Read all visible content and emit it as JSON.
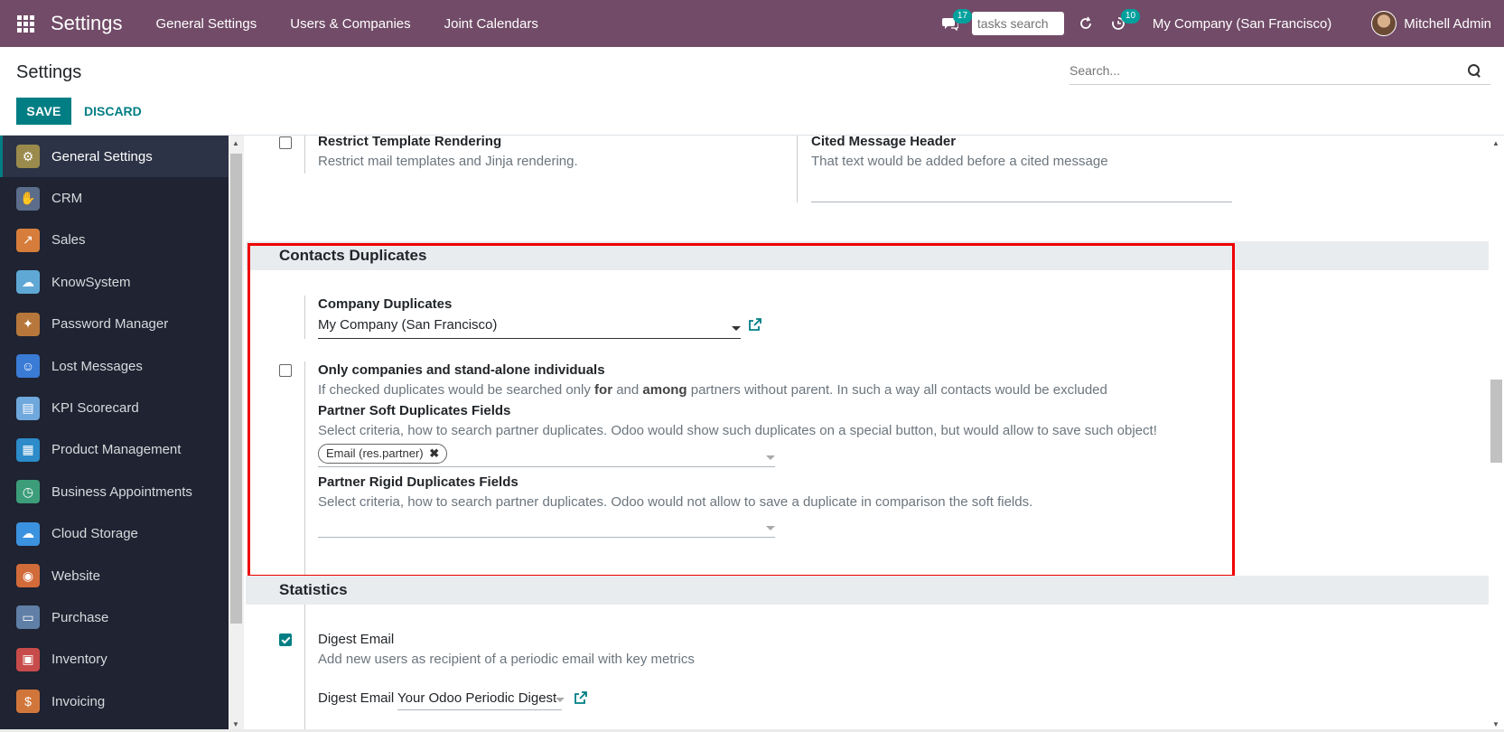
{
  "navbar": {
    "brand": "Settings",
    "menus": [
      "General Settings",
      "Users & Companies",
      "Joint Calendars"
    ],
    "messages_badge": "17",
    "task_search_placeholder": "tasks search",
    "activity_badge": "10",
    "company": "My Company (San Francisco)",
    "user": "Mitchell Admin"
  },
  "control_panel": {
    "title": "Settings",
    "save_label": "SAVE",
    "discard_label": "DISCARD",
    "search_placeholder": "Search..."
  },
  "sidebar": {
    "items": [
      {
        "label": "General Settings",
        "icon": "gear-icon",
        "color": "#9a8b4d",
        "active": true
      },
      {
        "label": "CRM",
        "icon": "handshake-icon",
        "color": "#5b6d8a"
      },
      {
        "label": "Sales",
        "icon": "chart-icon",
        "color": "#d67d3c"
      },
      {
        "label": "KnowSystem",
        "icon": "brain-icon",
        "color": "#5fa8d6"
      },
      {
        "label": "Password Manager",
        "icon": "puzzle-icon",
        "color": "#b7773b"
      },
      {
        "label": "Lost Messages",
        "icon": "user-icon",
        "color": "#3a7bd5"
      },
      {
        "label": "KPI Scorecard",
        "icon": "scorecard-icon",
        "color": "#6fa8dc"
      },
      {
        "label": "Product Management",
        "icon": "product-grid-icon",
        "color": "#2c8bc8"
      },
      {
        "label": "Business Appointments",
        "icon": "clock-icon",
        "color": "#3c9d7a"
      },
      {
        "label": "Cloud Storage",
        "icon": "cloud-icon",
        "color": "#3b93e0"
      },
      {
        "label": "Website",
        "icon": "globe-icon",
        "color": "#d16b3a"
      },
      {
        "label": "Purchase",
        "icon": "card-icon",
        "color": "#5f7fa6"
      },
      {
        "label": "Inventory",
        "icon": "box-icon",
        "color": "#c84b4b"
      },
      {
        "label": "Invoicing",
        "icon": "invoice-icon",
        "color": "#d1763b"
      }
    ]
  },
  "top_settings": {
    "restrict_title": "Restrict Template Rendering",
    "restrict_desc": "Restrict mail templates and Jinja rendering.",
    "cited_title": "Cited Message Header",
    "cited_desc": "That text would be added before a cited message"
  },
  "contacts_duplicates": {
    "heading": "Contacts Duplicates",
    "company_dup_label": "Company Duplicates",
    "company_dup_value": "My Company (San Francisco)",
    "only_companies_title": "Only companies and stand-alone individuals",
    "only_companies_desc_1": "If checked duplicates would be searched only ",
    "only_companies_desc_for": "for",
    "only_companies_desc_2": " and ",
    "only_companies_desc_among": "among",
    "only_companies_desc_3": " partners without parent. In such a way all contacts would be excluded",
    "soft_title": "Partner Soft Duplicates Fields",
    "soft_desc": "Select criteria, how to search partner duplicates. Odoo would show such duplicates on a special button, but would allow to save such object!",
    "soft_tag": "Email (res.partner)",
    "rigid_title": "Partner Rigid Duplicates Fields",
    "rigid_desc": "Select criteria, how to search partner duplicates. Odoo would not allow to save a duplicate in comparison the soft fields."
  },
  "statistics": {
    "heading": "Statistics",
    "digest_title": "Digest Email",
    "digest_desc": "Add new users as recipient of a periodic email with key metrics",
    "digest_field_label": "Digest Email",
    "digest_field_value": "Your Odoo Periodic Digest"
  },
  "colors": {
    "navbar": "#714B67",
    "accent": "#017E84",
    "sidebar": "#1f2332",
    "highlight": "#ee0000"
  }
}
